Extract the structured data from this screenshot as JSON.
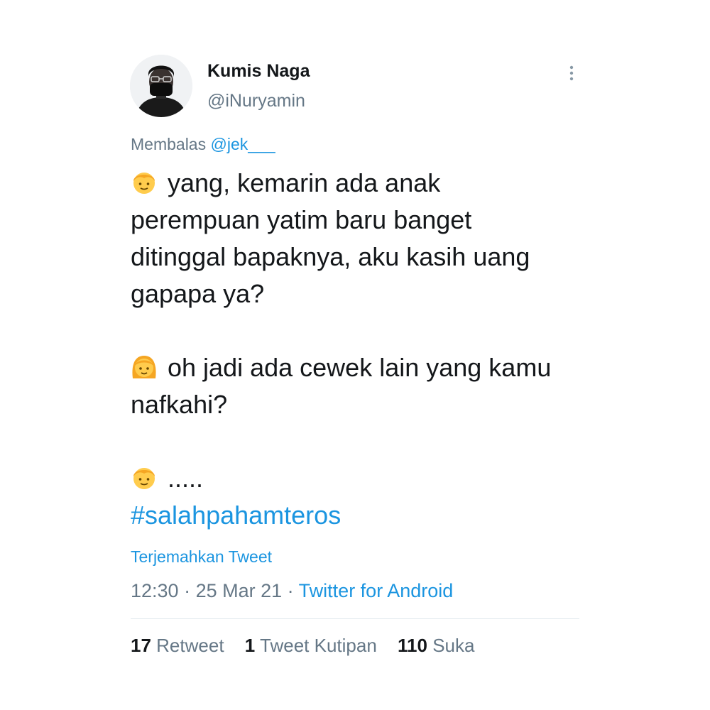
{
  "author": {
    "display_name": "Kumis Naga",
    "handle": "@iNuryamin",
    "avatar_icon": "user-avatar-masked-person"
  },
  "menu": {
    "icon": "more-vertical-icon"
  },
  "reply": {
    "prefix": "Membalas",
    "mention": "@jek___"
  },
  "tweet": {
    "paragraphs": [
      {
        "emoji": "boy-emoji",
        "text": "yang, kemarin ada anak perempuan yatim baru banget ditinggal bapaknya, aku kasih uang gapapa ya?"
      },
      {
        "emoji": "girl-emoji",
        "text": "oh jadi ada cewek lain yang kamu nafkahi?"
      },
      {
        "emoji": "boy-emoji",
        "text": "....."
      }
    ],
    "hashtag": "#salahpahamteros"
  },
  "translate_label": "Terjemahkan Tweet",
  "meta": {
    "time": "12:30",
    "separator": " · ",
    "date": "25 Mar 21",
    "source": "Twitter for Android"
  },
  "stats": {
    "retweets": {
      "count": "17",
      "label": "Retweet"
    },
    "quotes": {
      "count": "1",
      "label": "Tweet Kutipan"
    },
    "likes": {
      "count": "110",
      "label": "Suka"
    }
  },
  "colors": {
    "link": "#1b95e0",
    "secondary": "#657786",
    "primary": "#14171a",
    "emoji_face": "#ffcc4d",
    "emoji_hair": "#f5a623"
  }
}
